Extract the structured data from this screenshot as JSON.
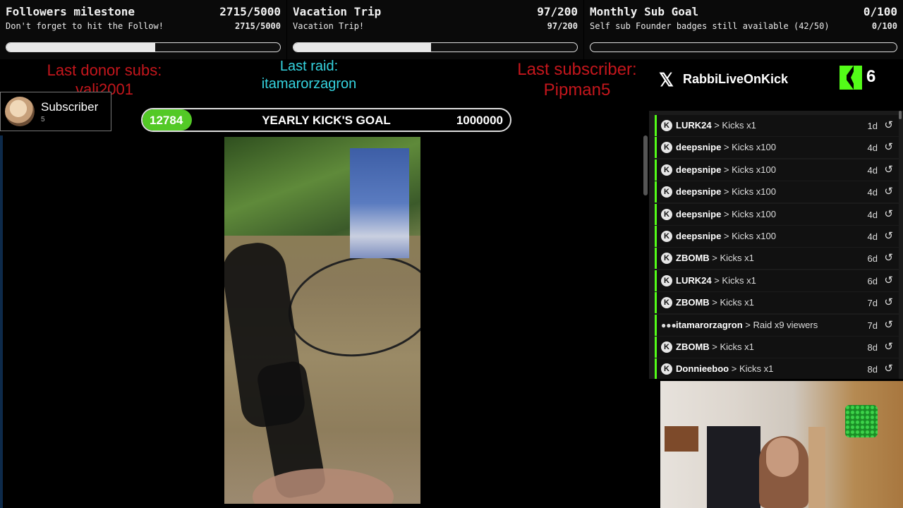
{
  "goals": [
    {
      "title": "Followers milestone",
      "subtitle": "Don't forget to hit the Follow!",
      "count": "2715/5000",
      "progress": 0.543
    },
    {
      "title": "Vacation Trip",
      "subtitle": "Vacation Trip!",
      "count": "97/200",
      "progress": 0.485
    },
    {
      "title": "Monthly Sub Goal",
      "subtitle": "Self sub Founder badges still available (42/50)",
      "count": "0/100",
      "progress": 0.0
    }
  ],
  "last_donor": {
    "label": "Last donor subs:",
    "name": "vali2001"
  },
  "last_raid": {
    "label": "Last raid:",
    "name": "itamarorzagron"
  },
  "last_subscriber": {
    "label": "Last subscriber:",
    "name": "Pipman5"
  },
  "subscriber_card": {
    "label": "Subscriber",
    "count": "5"
  },
  "kick_goal": {
    "current": "12784",
    "title": "YEARLY KICK'S GOAL",
    "target": "1000000",
    "progress": 0.012784
  },
  "social": {
    "handle": "RabbiLiveOnKick",
    "kick_count": "6"
  },
  "feed": [
    {
      "user": "LURK24",
      "event": "> Kicks x1",
      "age": "1d",
      "type": "kick"
    },
    {
      "user": "deepsnipe",
      "event": "> Kicks x100",
      "age": "4d",
      "type": "kick"
    },
    {
      "user": "deepsnipe",
      "event": "> Kicks x100",
      "age": "4d",
      "type": "kick"
    },
    {
      "user": "deepsnipe",
      "event": "> Kicks x100",
      "age": "4d",
      "type": "kick"
    },
    {
      "user": "deepsnipe",
      "event": "> Kicks x100",
      "age": "4d",
      "type": "kick"
    },
    {
      "user": "deepsnipe",
      "event": "> Kicks x100",
      "age": "4d",
      "type": "kick"
    },
    {
      "user": "ZBOMB",
      "event": "> Kicks x1",
      "age": "6d",
      "type": "kick"
    },
    {
      "user": "LURK24",
      "event": "> Kicks x1",
      "age": "6d",
      "type": "kick"
    },
    {
      "user": "ZBOMB",
      "event": "> Kicks x1",
      "age": "7d",
      "type": "kick"
    },
    {
      "user": "itamarorzagron",
      "event": "> Raid x9 viewers",
      "age": "7d",
      "type": "raid"
    },
    {
      "user": "ZBOMB",
      "event": "> Kicks x1",
      "age": "8d",
      "type": "kick"
    },
    {
      "user": "Donnieeboo",
      "event": "> Kicks x1",
      "age": "8d",
      "type": "kick"
    }
  ],
  "icons": {
    "kick_row": "kick-icon",
    "raid_row": "raid-icon",
    "replay": "replay-icon",
    "x_logo": "x-logo-icon",
    "kick_logo": "kick-logo-icon"
  },
  "colors": {
    "kick_green": "#53fc18",
    "alert_red": "#c4161c",
    "raid_cyan": "#35d4e0"
  }
}
